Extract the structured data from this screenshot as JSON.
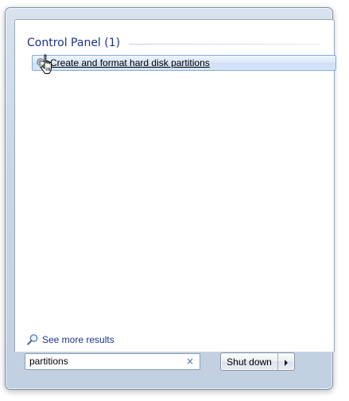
{
  "results": {
    "section_title": "Control Panel (1)",
    "items": [
      {
        "label": "Create and format hard disk partitions",
        "icon": "disk-management-icon"
      }
    ]
  },
  "see_more": {
    "label": "See more results",
    "icon": "magnifier-icon"
  },
  "search": {
    "value": "partitions",
    "clear_glyph": "×",
    "clear_icon": "clear-x-icon"
  },
  "shutdown": {
    "label": "Shut down",
    "arrow_icon": "arrow-right-icon"
  },
  "colors": {
    "header_text": "#1e3287",
    "highlight_border": "#84acdd",
    "highlight_fill": "#dae7fa",
    "clear_icon": "#3a6fbf"
  }
}
